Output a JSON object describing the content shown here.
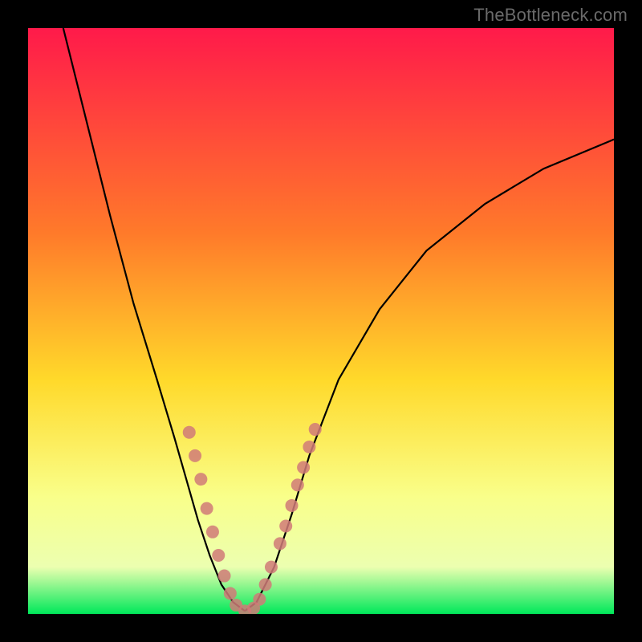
{
  "watermark": "TheBottleneck.com",
  "chart_data": {
    "type": "line",
    "title": "",
    "xlabel": "",
    "ylabel": "",
    "xlim": [
      0,
      100
    ],
    "ylim": [
      0,
      100
    ],
    "background_gradient": {
      "stops": [
        {
          "offset": 0,
          "color": "#ff1a4a"
        },
        {
          "offset": 35,
          "color": "#ff7a2a"
        },
        {
          "offset": 60,
          "color": "#ffd92a"
        },
        {
          "offset": 80,
          "color": "#f9ff8a"
        },
        {
          "offset": 92,
          "color": "#ecffb0"
        },
        {
          "offset": 100,
          "color": "#00e85a"
        }
      ]
    },
    "series": [
      {
        "name": "left-curve",
        "stroke": "#000000",
        "points": [
          {
            "x": 6,
            "y": 100
          },
          {
            "x": 10,
            "y": 84
          },
          {
            "x": 14,
            "y": 68
          },
          {
            "x": 18,
            "y": 53
          },
          {
            "x": 22,
            "y": 40
          },
          {
            "x": 25,
            "y": 30
          },
          {
            "x": 27,
            "y": 23
          },
          {
            "x": 29,
            "y": 16
          },
          {
            "x": 31,
            "y": 10
          },
          {
            "x": 33,
            "y": 5
          },
          {
            "x": 35,
            "y": 2
          },
          {
            "x": 37,
            "y": 0.5
          }
        ]
      },
      {
        "name": "right-curve",
        "stroke": "#000000",
        "points": [
          {
            "x": 37,
            "y": 0.5
          },
          {
            "x": 39,
            "y": 2
          },
          {
            "x": 42,
            "y": 8
          },
          {
            "x": 45,
            "y": 17
          },
          {
            "x": 48,
            "y": 27
          },
          {
            "x": 53,
            "y": 40
          },
          {
            "x": 60,
            "y": 52
          },
          {
            "x": 68,
            "y": 62
          },
          {
            "x": 78,
            "y": 70
          },
          {
            "x": 88,
            "y": 76
          },
          {
            "x": 100,
            "y": 81
          }
        ]
      }
    ],
    "markers": {
      "name": "data-points",
      "color": "#d07a78",
      "radius_px": 8,
      "points": [
        {
          "x": 27.5,
          "y": 31
        },
        {
          "x": 28.5,
          "y": 27
        },
        {
          "x": 29.5,
          "y": 23
        },
        {
          "x": 30.5,
          "y": 18
        },
        {
          "x": 31.5,
          "y": 14
        },
        {
          "x": 32.5,
          "y": 10
        },
        {
          "x": 33.5,
          "y": 6.5
        },
        {
          "x": 34.5,
          "y": 3.5
        },
        {
          "x": 35.5,
          "y": 1.5
        },
        {
          "x": 37,
          "y": 0.5
        },
        {
          "x": 38.5,
          "y": 1
        },
        {
          "x": 39.5,
          "y": 2.5
        },
        {
          "x": 40.5,
          "y": 5
        },
        {
          "x": 41.5,
          "y": 8
        },
        {
          "x": 43,
          "y": 12
        },
        {
          "x": 44,
          "y": 15
        },
        {
          "x": 45,
          "y": 18.5
        },
        {
          "x": 46,
          "y": 22
        },
        {
          "x": 47,
          "y": 25
        },
        {
          "x": 48,
          "y": 28.5
        },
        {
          "x": 49,
          "y": 31.5
        }
      ]
    }
  }
}
